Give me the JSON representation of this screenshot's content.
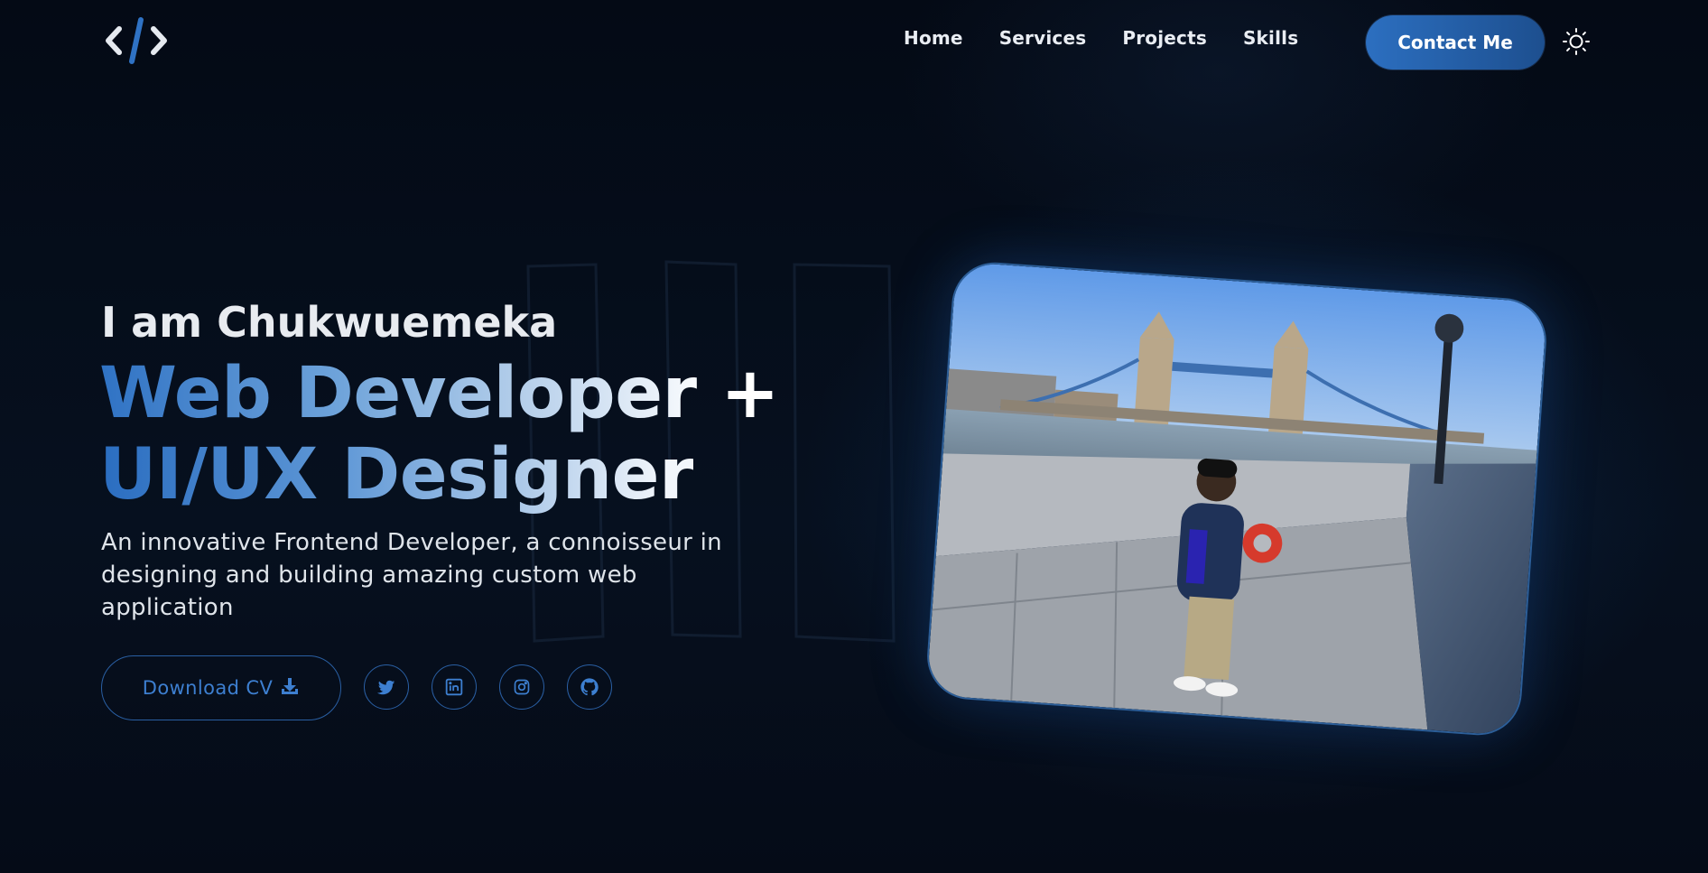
{
  "header": {
    "logo_icon": "code-brackets-icon",
    "nav": [
      {
        "label": "Home"
      },
      {
        "label": "Services"
      },
      {
        "label": "Projects"
      },
      {
        "label": "Skills"
      }
    ],
    "contact_label": "Contact Me",
    "theme_icon": "sun-icon"
  },
  "hero": {
    "greeting": "I am Chukwuemeka",
    "headline_line1": "Web Developer +",
    "headline_line2": "UI/UX Designer",
    "description": "An innovative Frontend Developer, a connoisseur in designing and building amazing custom web application",
    "download_label": "Download CV",
    "download_icon": "download-icon",
    "socials": [
      {
        "icon": "twitter-icon"
      },
      {
        "icon": "linkedin-icon"
      },
      {
        "icon": "instagram-icon"
      },
      {
        "icon": "github-icon"
      }
    ]
  },
  "colors": {
    "background": "#050b17",
    "accent": "#2c6fc0",
    "text": "#e9edf3"
  }
}
